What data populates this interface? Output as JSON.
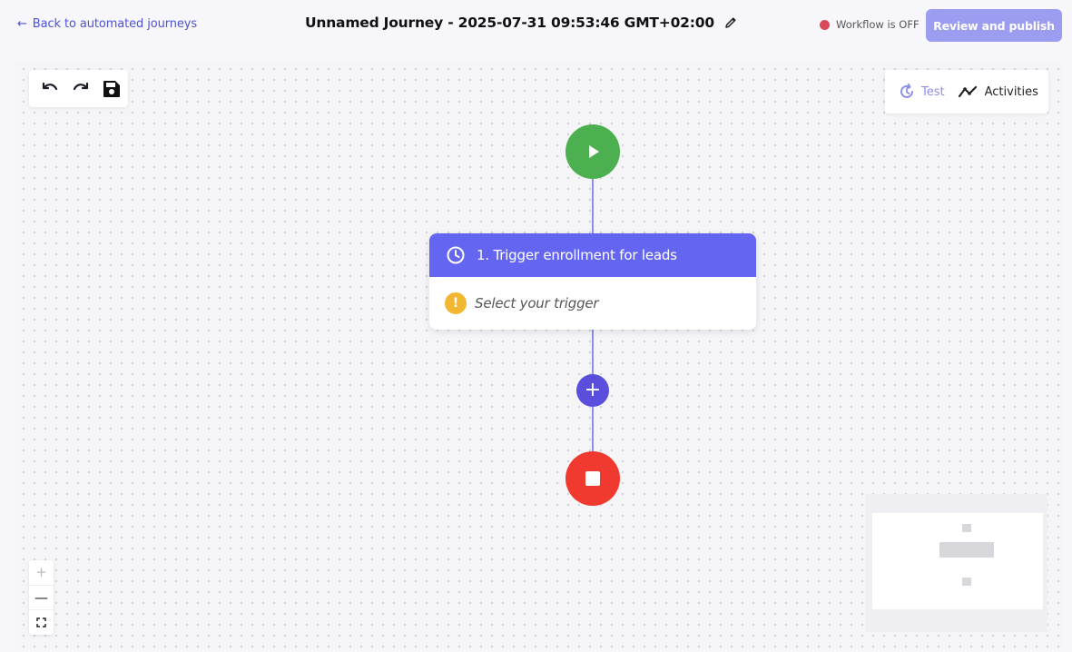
{
  "header": {
    "back_label": "Back to automated journeys",
    "back_arrow": "←",
    "title": "Unnamed Journey - 2025-07-31 09:53:46 GMT+02:00",
    "workflow_status": "Workflow is OFF",
    "publish_label": "Review and publish"
  },
  "toolbar": {
    "undo_icon": "undo-icon",
    "redo_icon": "redo-icon",
    "save_icon": "save-icon"
  },
  "panel": {
    "test_label": "Test",
    "activities_label": "Activities"
  },
  "flow": {
    "trigger_title": "1. Trigger enrollment for leads",
    "trigger_placeholder": "Select your trigger",
    "warning_glyph": "!",
    "add_glyph": "+"
  },
  "zoom": {
    "zoom_in": "+",
    "zoom_out": "—",
    "fit": "⛶"
  },
  "colors": {
    "accent": "#6466f1",
    "publish_button": "#9c9cf0",
    "start_node": "#4caf50",
    "end_node": "#f0392f",
    "add_node": "#5a4fdc",
    "status_off": "#d84a5c",
    "warning": "#f2b731"
  }
}
